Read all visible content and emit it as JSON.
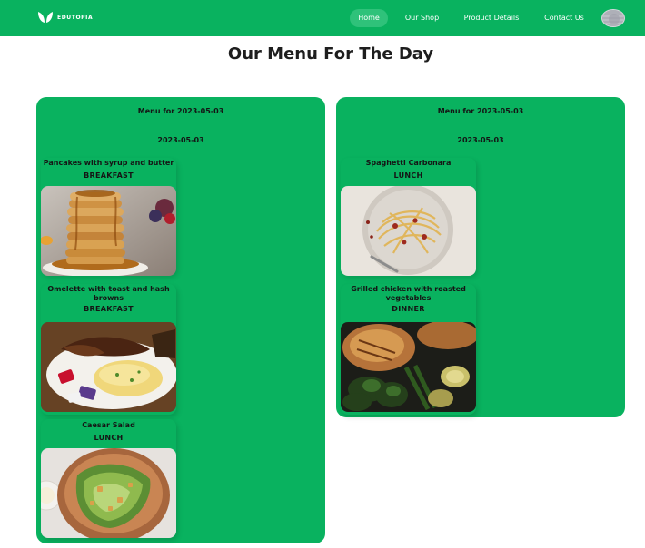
{
  "nav": {
    "brand": "EDUTOPIA",
    "links": [
      "Home",
      "Our Shop",
      "Product Details",
      "Contact Us"
    ],
    "active": "Home"
  },
  "page": {
    "title": "Our Menu For The Day"
  },
  "menus": [
    {
      "heading": "Menu for 2023-05-03",
      "date": "2023-05-03",
      "items": [
        {
          "name": "Pancakes with syrup and butter",
          "type": "BREAKFAST",
          "icon": "pancakes-photo"
        },
        {
          "name": "Omelette with toast and hash browns",
          "type": "BREAKFAST",
          "icon": "omelette-photo"
        },
        {
          "name": "Caesar Salad",
          "type": "LUNCH",
          "icon": "caesar-salad-photo"
        }
      ]
    },
    {
      "heading": "Menu for 2023-05-03",
      "date": "2023-05-03",
      "items": [
        {
          "name": "Spaghetti Carbonara",
          "type": "LUNCH",
          "icon": "spaghetti-photo"
        },
        {
          "name": "Grilled chicken with roasted vegetables",
          "type": "DINNER",
          "icon": "grilled-chicken-photo"
        }
      ]
    }
  ],
  "colors": {
    "brand": "#09b25f",
    "active_pill": "#2fc27a",
    "text": "#1e1e1e"
  }
}
